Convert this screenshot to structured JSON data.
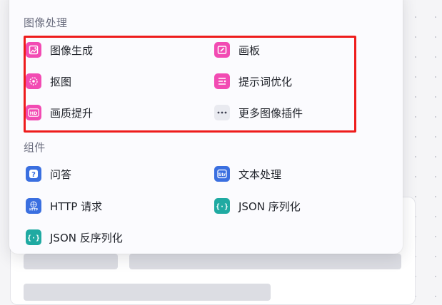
{
  "sections": {
    "image_processing": {
      "title": "图像处理",
      "items": [
        {
          "label": "图像生成",
          "icon": "image-generation-icon",
          "color": "#f24bb3"
        },
        {
          "label": "画板",
          "icon": "canvas-board-icon",
          "color": "#f24bb3"
        },
        {
          "label": "抠图",
          "icon": "cutout-icon",
          "color": "#f24bb3"
        },
        {
          "label": "提示词优化",
          "icon": "prompt-optimize-icon",
          "color": "#f24bb3"
        },
        {
          "label": "画质提升",
          "icon": "hd-icon",
          "color": "#f24bb3"
        },
        {
          "label": "更多图像插件",
          "icon": "more-icon",
          "color": "#e9eaf0"
        }
      ]
    },
    "components": {
      "title": "组件",
      "items": [
        {
          "label": "问答",
          "icon": "question-icon",
          "color": "#3a6fe0"
        },
        {
          "label": "文本处理",
          "icon": "text-processing-icon",
          "color": "#3a6fe0"
        },
        {
          "label": "HTTP 请求",
          "icon": "http-icon",
          "color": "#3a6fe0"
        },
        {
          "label": "JSON 序列化",
          "icon": "json-serialize-icon",
          "color": "#1faaa2"
        },
        {
          "label": "JSON 反序列化",
          "icon": "json-deserialize-icon",
          "color": "#1faaa2"
        }
      ]
    }
  },
  "highlight_color": "#ee1c1c"
}
